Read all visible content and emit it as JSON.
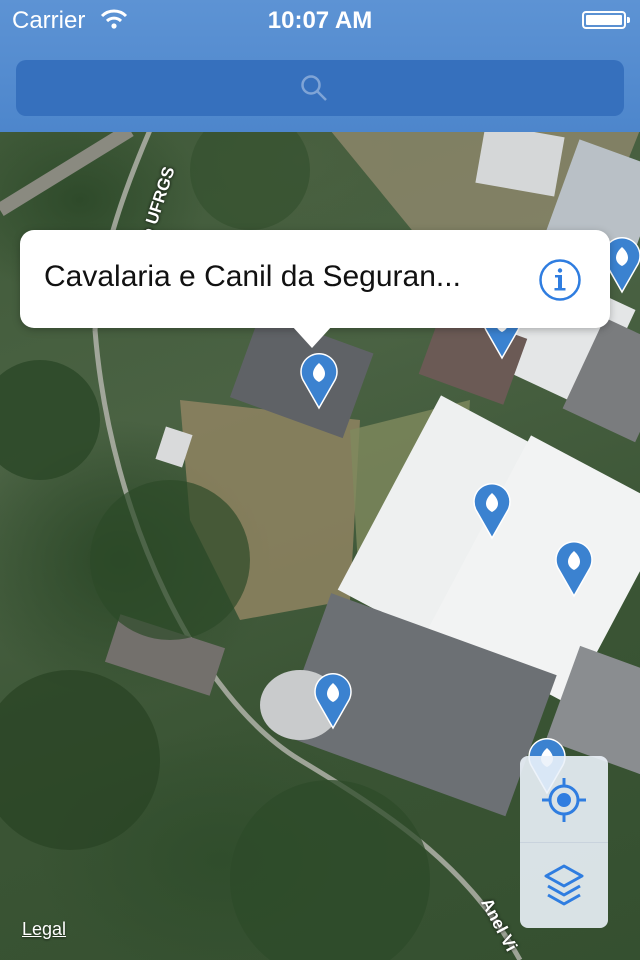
{
  "status_bar": {
    "carrier": "Carrier",
    "time": "10:07 AM"
  },
  "search": {
    "icon": "search-icon"
  },
  "map": {
    "road_label_1": "Anel Viário UFRGS",
    "road_label_2": "Anel Vi",
    "legal": "Legal"
  },
  "callout": {
    "title": "Cavalaria e Canil da Seguran...",
    "icon": "info-icon"
  },
  "controls": {
    "locate_icon": "locate-icon",
    "layers_icon": "layers-icon"
  },
  "colors": {
    "bar": "#5d93d4",
    "accent": "#2f7de0",
    "pin": "#3b82d0"
  }
}
